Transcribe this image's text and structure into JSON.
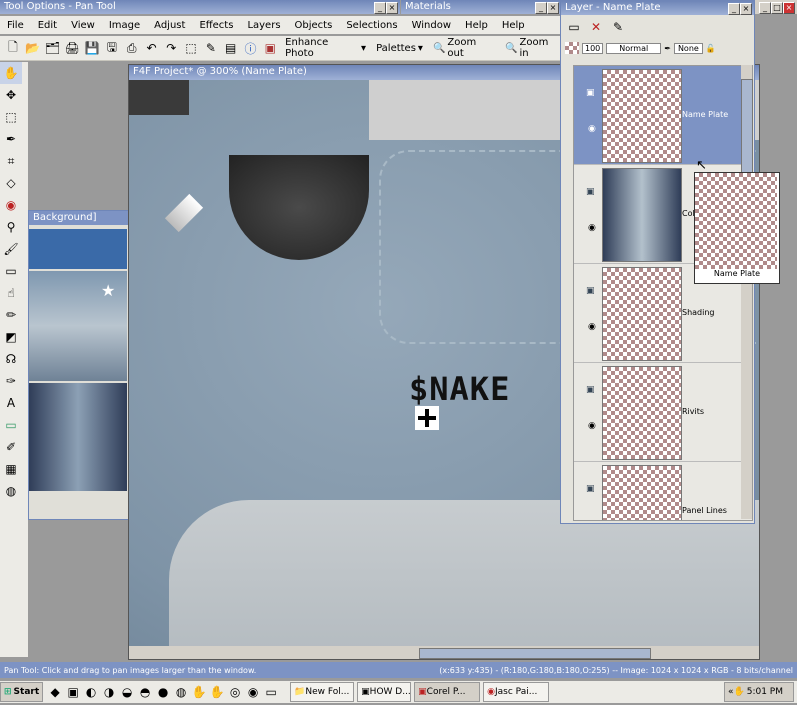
{
  "tool_options": {
    "title": "Tool Options - Pan Tool"
  },
  "materials": {
    "title": "Materials"
  },
  "menu": [
    "File",
    "Edit",
    "View",
    "Image",
    "Adjust",
    "Effects",
    "Layers",
    "Objects",
    "Selections",
    "Window",
    "Help",
    "Help"
  ],
  "toolbar": {
    "enhance_label": "Enhance Photo",
    "palettes_label": "Palettes",
    "zoom_out_label": "Zoom out",
    "zoom_in_label": "Zoom in"
  },
  "canvas": {
    "title": "F4F Project* @ 300% (Name Plate)",
    "nameplate_text": "$NAKE"
  },
  "background_window": {
    "title": "Background]"
  },
  "layer_palette": {
    "title": "Layer - Name Plate",
    "opacity": "100",
    "blend_mode": "Normal",
    "link_label": "None",
    "layers": [
      {
        "name": "Name Plate"
      },
      {
        "name": "Color Gr..."
      },
      {
        "name": "Shading"
      },
      {
        "name": "Rivits"
      },
      {
        "name": "Panel Lines"
      }
    ],
    "drag_preview_label": "Name Plate"
  },
  "status": {
    "hint": "Pan Tool: Click and drag to pan images larger than the window.",
    "info": "(x:633 y:435) -  (R:180,G:180,B:180,O:255) -- Image:  1024 x 1024 x RGB - 8 bits/channel"
  },
  "taskbar": {
    "start_label": "Start",
    "tasks": [
      "New Fol...",
      "HOW D...",
      "Corel P...",
      "Jasc Pai..."
    ],
    "clock": "5:01 PM"
  },
  "colors": {
    "titlebar": "#6f86b8",
    "metal": "#8fa3b4",
    "selected_layer": "#7d93c4"
  }
}
